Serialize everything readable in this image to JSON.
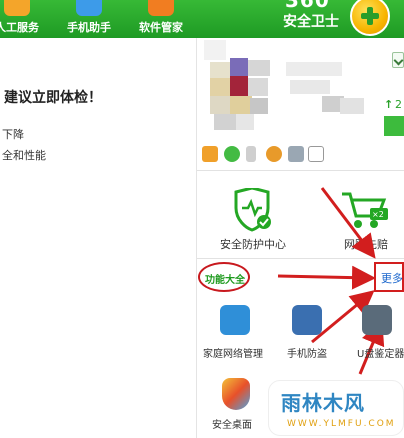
{
  "header": {
    "nav": [
      {
        "label": "人工服务"
      },
      {
        "label": "手机助手"
      },
      {
        "label": "软件管家"
      }
    ],
    "brand_number": "360",
    "brand_text": "安全卫士"
  },
  "left": {
    "title": "建议立即体检！",
    "lines": [
      "下降",
      "全和性能"
    ]
  },
  "right": {
    "side_number": "2",
    "big_items": [
      {
        "label": "安全防护中心"
      },
      {
        "label": "网购先赔"
      }
    ],
    "badge": "×2",
    "function_title": "功能大全",
    "more_label": "更多",
    "apps": [
      {
        "label": "家庭网络管理"
      },
      {
        "label": "手机防盗"
      },
      {
        "label": "U盘鉴定器"
      },
      {
        "label": "安全桌面"
      }
    ]
  },
  "watermark": {
    "main": "雨林木风",
    "url": "WWW.YLMFU.COM"
  },
  "colors": {
    "header_green": "#2fae2f",
    "annotation_red": "#d21e1e",
    "more_link_blue": "#1a66cc"
  }
}
